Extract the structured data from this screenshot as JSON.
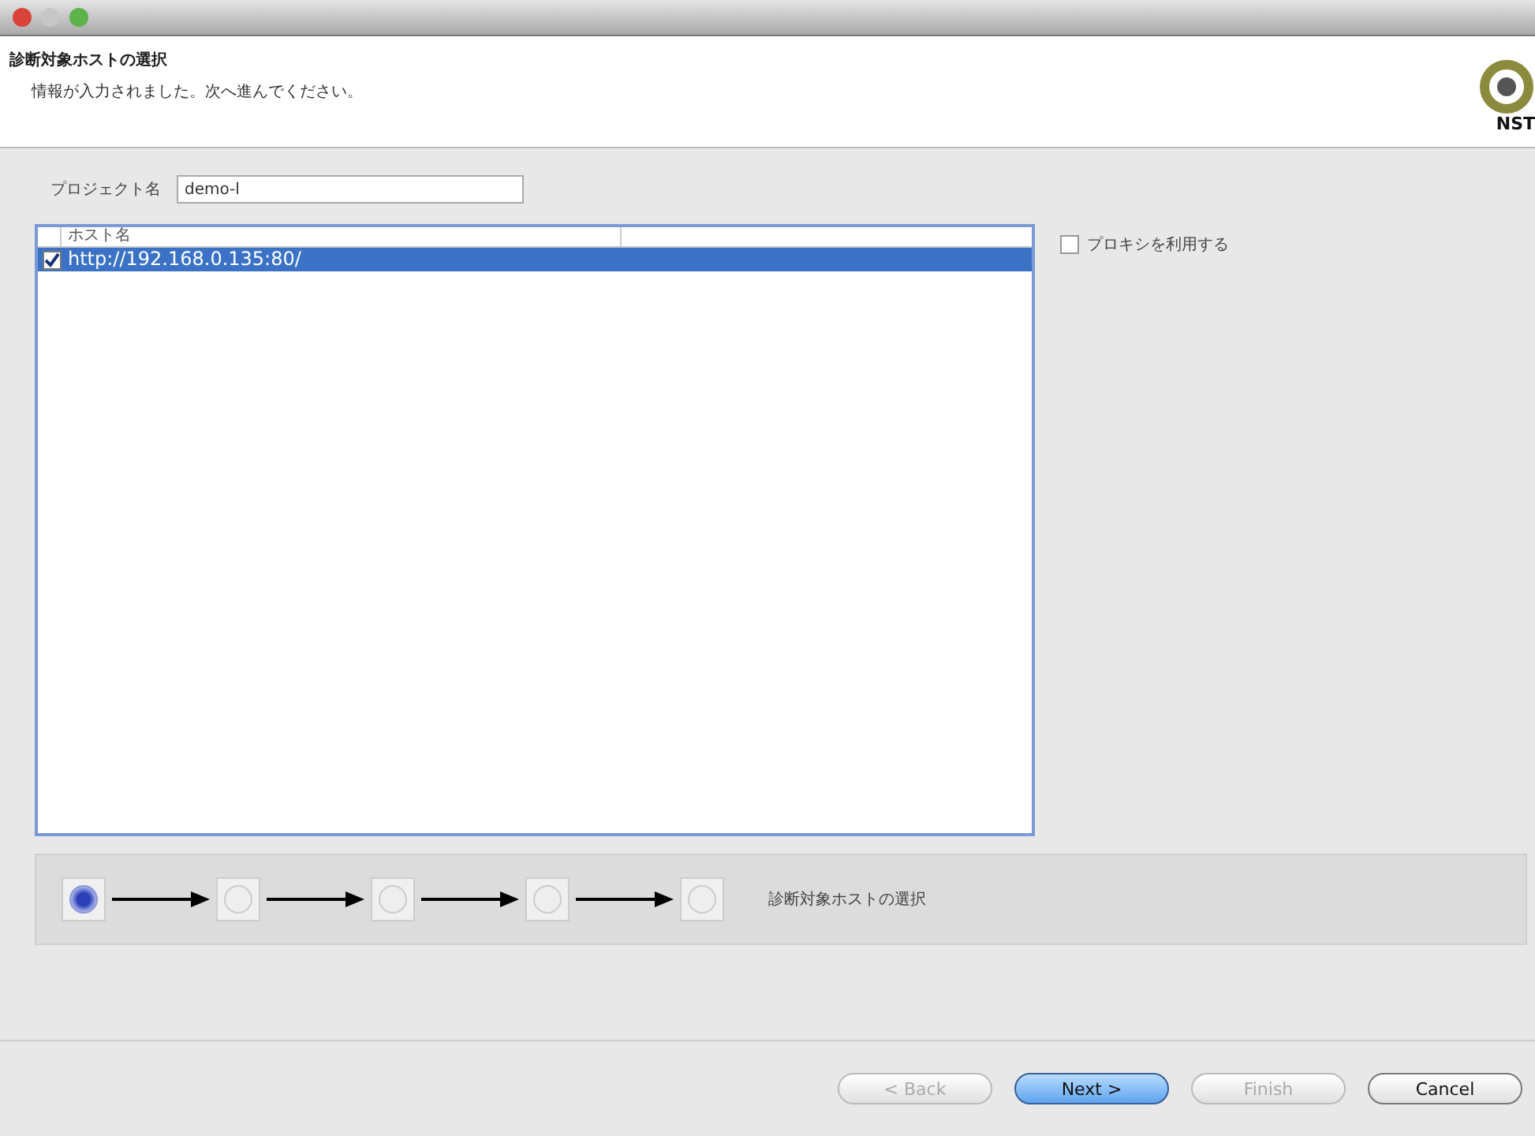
{
  "header": {
    "title": "診断対象ホストの選択",
    "message": "情報が入力されました。次へ進んでください。",
    "logo_text": "NST"
  },
  "project": {
    "label": "プロジェクト名",
    "value": "demo-l"
  },
  "table": {
    "columns": [
      "ホスト名"
    ],
    "rows": [
      {
        "host": "http://192.168.0.135:80/",
        "checked": true,
        "selected": true
      }
    ]
  },
  "proxy": {
    "label": "プロキシを利用する",
    "checked": false
  },
  "steps": [
    {
      "selected": true
    },
    {
      "selected": false
    },
    {
      "selected": false
    },
    {
      "selected": false
    },
    {
      "selected": false
    }
  ],
  "step_label": "診断対象ホストの選択",
  "buttons": [
    {
      "label": "< Back",
      "disabled": true,
      "kind": "normal"
    },
    {
      "label": "Next >",
      "disabled": false,
      "kind": "default"
    },
    {
      "label": "Finish",
      "disabled": true,
      "kind": "normal"
    },
    {
      "label": "Cancel",
      "disabled": false,
      "kind": "normal"
    }
  ]
}
